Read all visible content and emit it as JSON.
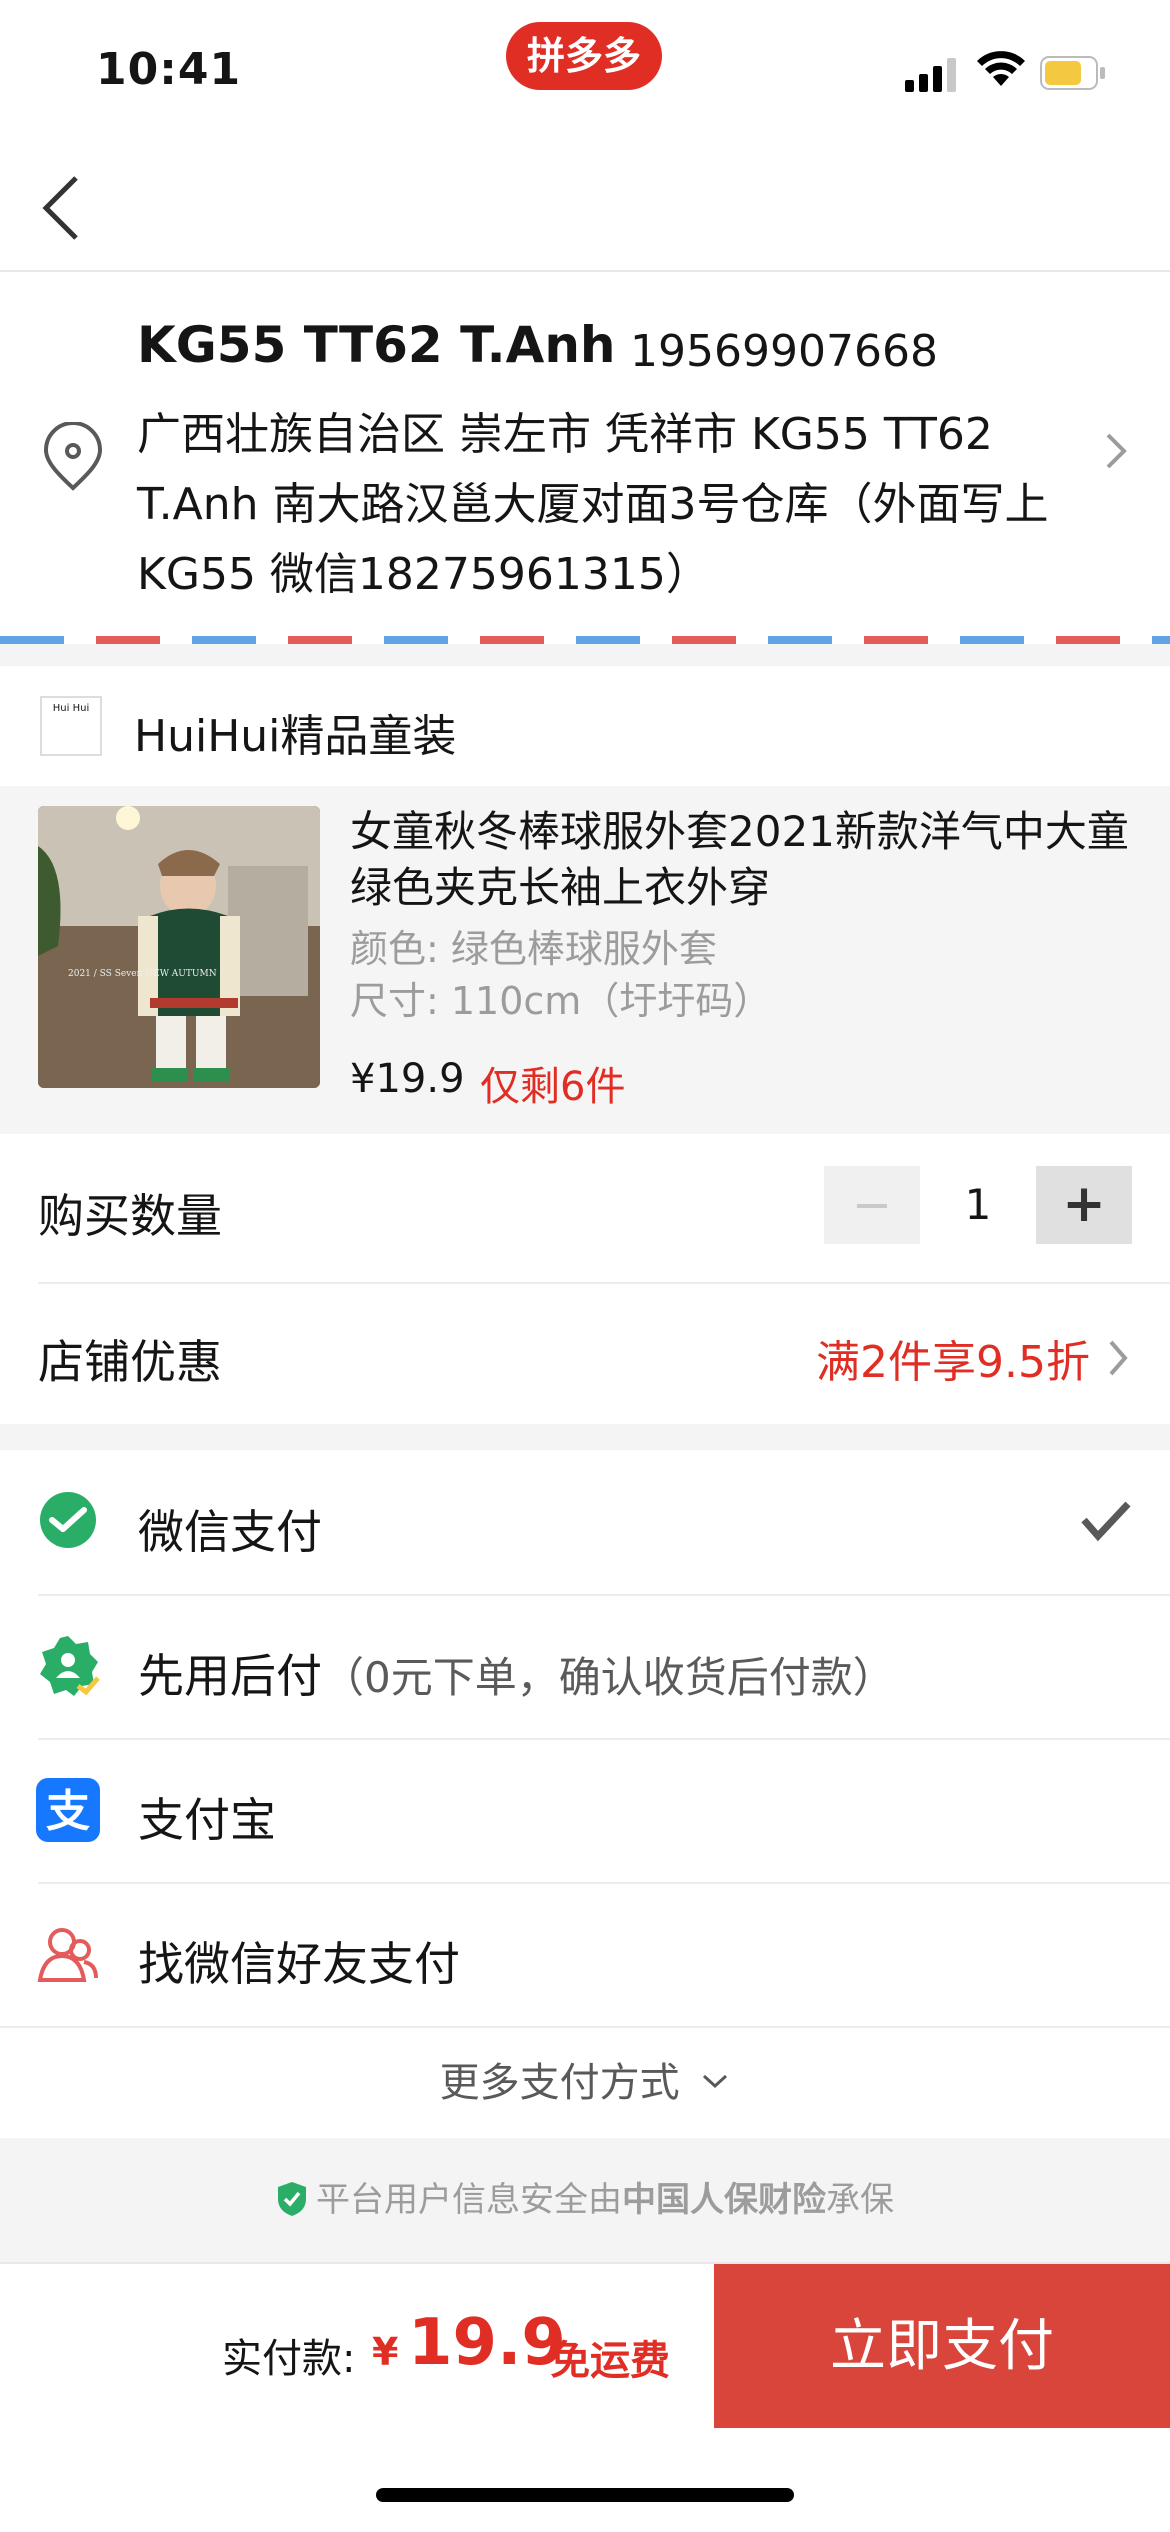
{
  "status_bar": {
    "time": "10:41",
    "app_badge": "拼多多"
  },
  "address": {
    "name": "KG55 TT62 T.Anh",
    "phone": "19569907668",
    "detail": "广西壮族自治区 崇左市 凭祥市 KG55 TT62 T.Anh 南大路汉邕大厦对面3号仓库（外面写上KG55 微信18275961315）"
  },
  "shop": {
    "name": "HuiHui精品童装",
    "logo_text": "Hui Hui"
  },
  "product": {
    "title": "女童秋冬棒球服外套2021新款洋气中大童绿色夹克长袖上衣外穿",
    "color": "颜色: 绿色棒球服外套",
    "size": "尺寸: 110cm（圩圩码）",
    "price": "¥19.9",
    "stock": "仅剩6件",
    "image_caption": "2021 / SS Seven NEW AUTUMN"
  },
  "quantity": {
    "label": "购买数量",
    "minus": "−",
    "value": "1",
    "plus": "+"
  },
  "discount": {
    "label": "店铺优惠",
    "value": "满2件享9.5折"
  },
  "payment": {
    "options": [
      {
        "label": "微信支付",
        "note": "",
        "selected": true
      },
      {
        "label": "先用后付",
        "note": "（0元下单，确认收货后付款）",
        "selected": false
      },
      {
        "label": "支付宝",
        "note": "",
        "selected": false
      },
      {
        "label": "找微信好友支付",
        "note": "",
        "selected": false
      }
    ],
    "more": "更多支付方式"
  },
  "insurance": {
    "prefix": "平台用户信息安全由",
    "brand": "中国人保财险",
    "suffix": "承保"
  },
  "checkout": {
    "total_label": "实付款:",
    "currency": "¥",
    "total": "19.9",
    "shipping": "免运费",
    "button": "立即支付"
  },
  "colors": {
    "accent": "#e02e24",
    "pay_button": "#d9453b",
    "wechat": "#2aae67",
    "alipay": "#1677ff"
  }
}
